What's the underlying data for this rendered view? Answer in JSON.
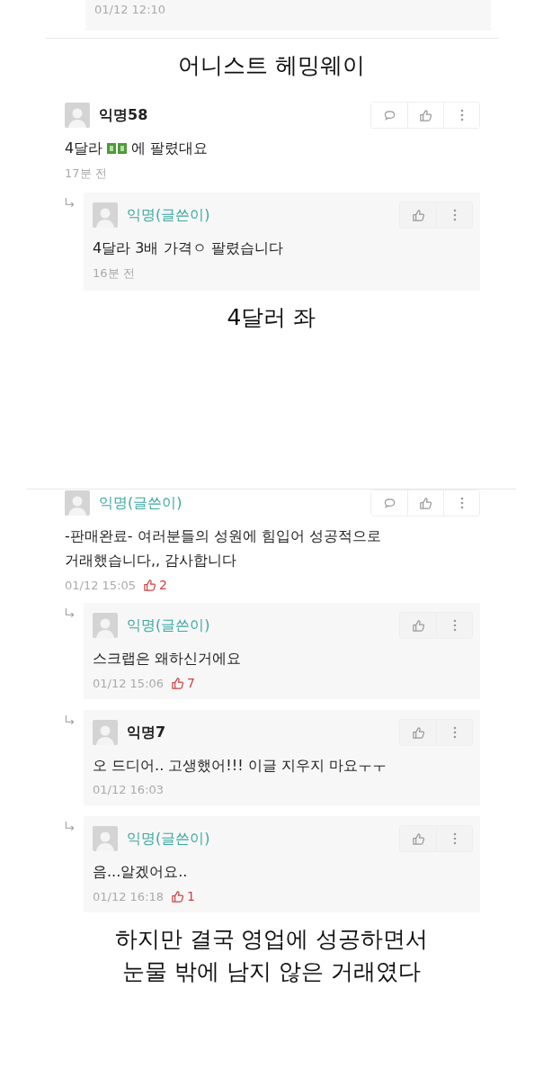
{
  "blocks": [
    {
      "kind": "tail",
      "time": "01/12 12:10"
    },
    {
      "kind": "divider"
    },
    {
      "kind": "caption",
      "lines": [
        "어니스트 헤밍웨이"
      ]
    },
    {
      "kind": "thread",
      "comments": [
        {
          "name": "익명58",
          "author": false,
          "reply": false,
          "parts": [
            {
              "kind": "text",
              "text": "4달라"
            },
            {
              "kind": "money"
            },
            {
              "kind": "text",
              "text": "에 팔렸대요"
            }
          ],
          "time": "17분 전"
        },
        {
          "name": "익명(글쓴이)",
          "author": true,
          "reply": true,
          "text": "4달라 3배 가격ㅇ 팔렸습니다",
          "time": "16분 전"
        }
      ]
    },
    {
      "kind": "caption",
      "lines": [
        "4달러 좌"
      ]
    },
    {
      "kind": "divider"
    },
    {
      "kind": "thread",
      "comments": [
        {
          "name": "익명(글쓴이)",
          "author": true,
          "reply": false,
          "text": "-판매완료- 여러분들의 성원에 힘입어 성공적으로 거래했습니다,, 감사합니다",
          "time": "01/12 15:05",
          "likes": "2"
        },
        {
          "name": "익명(글쓴이)",
          "author": true,
          "reply": true,
          "text": "스크랩은 왜하신거에요",
          "time": "01/12 15:06",
          "likes": "7"
        },
        {
          "name": "익명7",
          "author": false,
          "reply": true,
          "text": "오 드디어.. 고생했어!!! 이글 지우지 마요ㅜㅜ",
          "time": "01/12 16:03"
        },
        {
          "name": "익명(글쓴이)",
          "author": true,
          "reply": true,
          "text": "음...알겠어요..",
          "time": "01/12 16:18",
          "likes": "1"
        }
      ]
    },
    {
      "kind": "caption",
      "lines": [
        "하지만 결국 영업에 성공하면서",
        "눈물 밖에 남지 않은 거래였다"
      ]
    }
  ]
}
